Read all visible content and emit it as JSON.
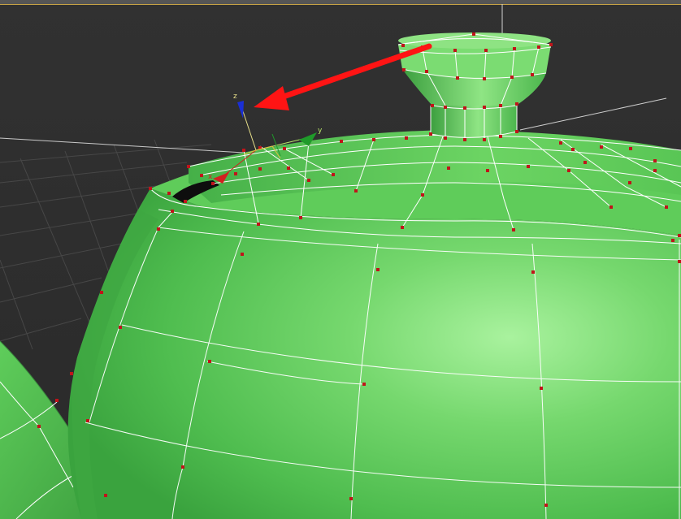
{
  "viewport": {
    "background": "#2d2d2d",
    "frame_accent": "#c7a345",
    "grid_color": "#4a4a4a",
    "grid_horizon_color": "#bdbdbd"
  },
  "mesh": {
    "object": "teapot",
    "fill": "#56c456",
    "highlight": "#a3ef9a",
    "shadow": "#2f8f34",
    "edge_color": "#ffffff",
    "vertex_color": "#c0141a"
  },
  "gizmo": {
    "z_label": "z",
    "y_label": "y",
    "x_label": "x",
    "z_color": "#1a2fd6",
    "y_color": "#1f9a2a",
    "x_color": "#d32020",
    "z_label_color": "#e8e08a",
    "y_label_color": "#b9e86a"
  },
  "annotation": {
    "arrow_color": "#ff1414",
    "arrow_icon": "red-arrow-icon"
  }
}
